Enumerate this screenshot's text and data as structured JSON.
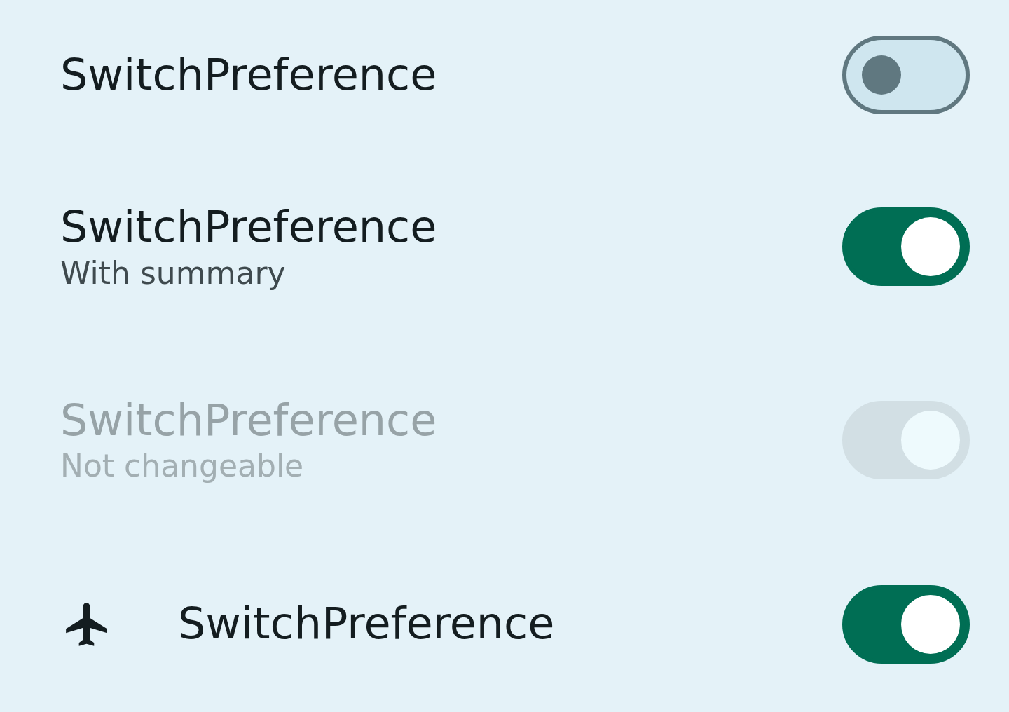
{
  "preferences": [
    {
      "kind": "plain",
      "title": "SwitchPreference",
      "checked": false,
      "disabled": false
    },
    {
      "kind": "plain",
      "title": "SwitchPreference",
      "summary": "With summary",
      "checked": true,
      "disabled": false
    },
    {
      "kind": "plain",
      "title": "SwitchPreference",
      "summary": "Not changeable",
      "checked": true,
      "disabled": true
    },
    {
      "kind": "icon",
      "title": "SwitchPreference",
      "checked": true,
      "disabled": false
    }
  ]
}
